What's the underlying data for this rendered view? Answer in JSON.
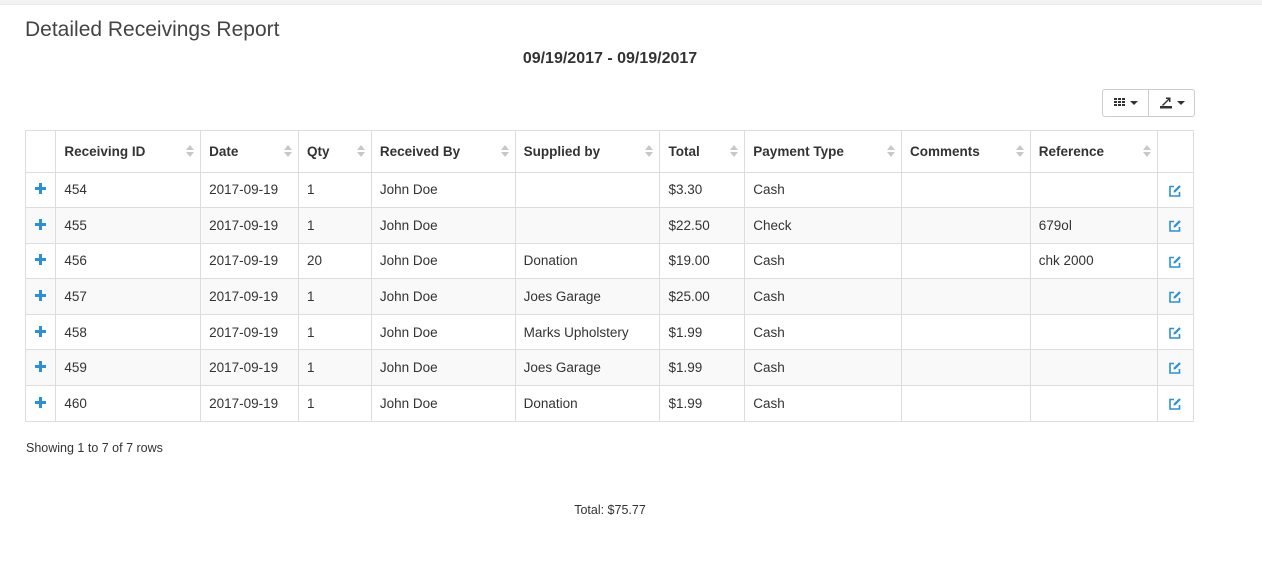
{
  "report": {
    "title": "Detailed Receivings Report",
    "date_range": "09/19/2017 - 09/19/2017"
  },
  "toolbar": {
    "columns_icon": "grid-icon",
    "export_icon": "export-icon"
  },
  "table": {
    "headers": [
      "Receiving ID",
      "Date",
      "Qty",
      "Received By",
      "Supplied by",
      "Total",
      "Payment Type",
      "Comments",
      "Reference"
    ],
    "rows": [
      {
        "id": "454",
        "date": "2017-09-19",
        "qty": "1",
        "received_by": "John Doe",
        "supplied_by": "",
        "total": "$3.30",
        "payment_type": "Cash",
        "comments": "",
        "reference": ""
      },
      {
        "id": "455",
        "date": "2017-09-19",
        "qty": "1",
        "received_by": "John Doe",
        "supplied_by": "",
        "total": "$22.50",
        "payment_type": "Check",
        "comments": "",
        "reference": "679ol"
      },
      {
        "id": "456",
        "date": "2017-09-19",
        "qty": "20",
        "received_by": "John Doe",
        "supplied_by": "Donation",
        "total": "$19.00",
        "payment_type": "Cash",
        "comments": "",
        "reference": "chk 2000"
      },
      {
        "id": "457",
        "date": "2017-09-19",
        "qty": "1",
        "received_by": "John Doe",
        "supplied_by": "Joes Garage",
        "total": "$25.00",
        "payment_type": "Cash",
        "comments": "",
        "reference": ""
      },
      {
        "id": "458",
        "date": "2017-09-19",
        "qty": "1",
        "received_by": "John Doe",
        "supplied_by": "Marks Upholstery",
        "total": "$1.99",
        "payment_type": "Cash",
        "comments": "",
        "reference": ""
      },
      {
        "id": "459",
        "date": "2017-09-19",
        "qty": "1",
        "received_by": "John Doe",
        "supplied_by": "Joes Garage",
        "total": "$1.99",
        "payment_type": "Cash",
        "comments": "",
        "reference": ""
      },
      {
        "id": "460",
        "date": "2017-09-19",
        "qty": "1",
        "received_by": "John Doe",
        "supplied_by": "Donation",
        "total": "$1.99",
        "payment_type": "Cash",
        "comments": "",
        "reference": ""
      }
    ]
  },
  "pagination": {
    "summary": "Showing 1 to 7 of 7 rows"
  },
  "footer": {
    "total": "Total: $75.77"
  },
  "colors": {
    "accent": "#2a91d8",
    "border": "#dddddd",
    "stripe": "#f9f9f9"
  }
}
